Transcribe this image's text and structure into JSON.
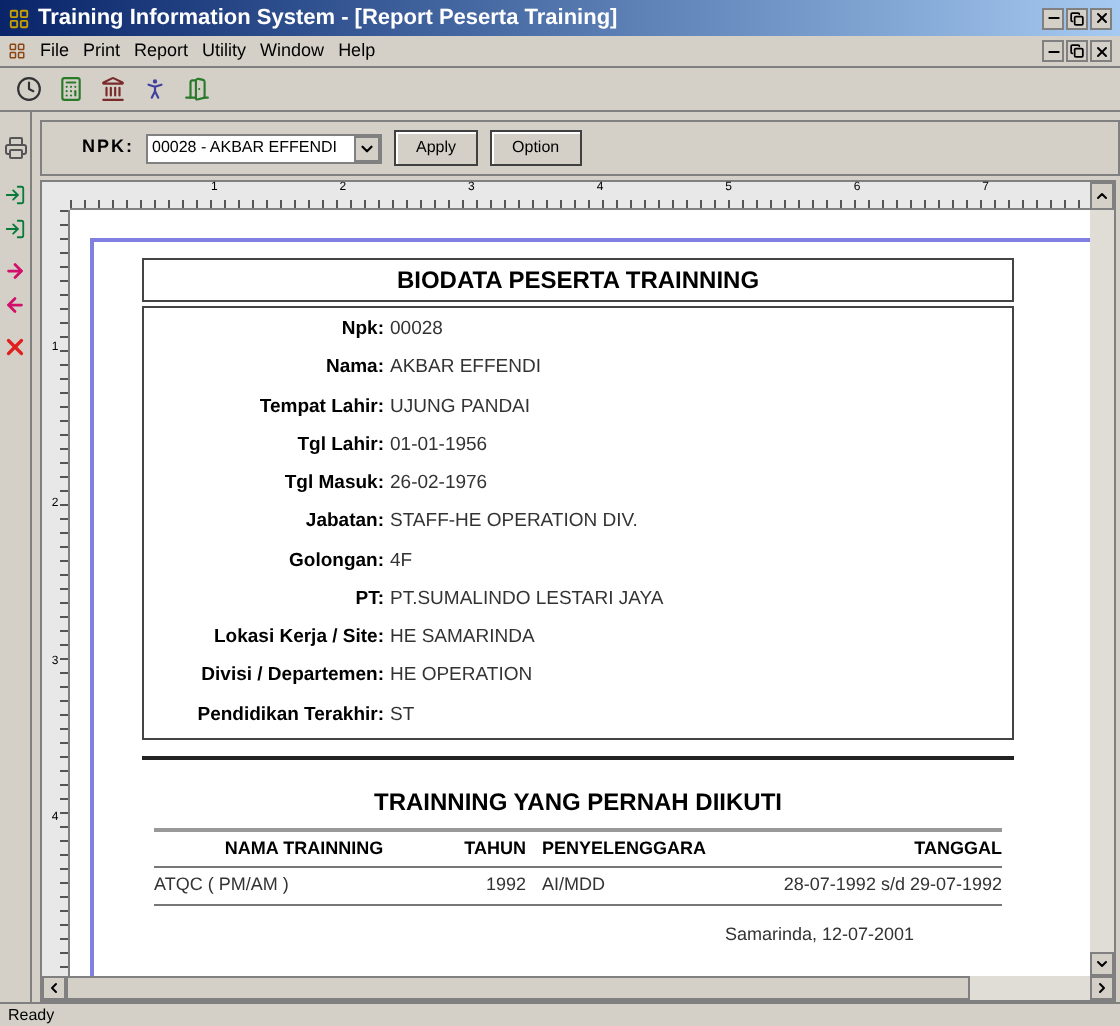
{
  "window": {
    "title": "Training Information System - [Report Peserta Training]"
  },
  "menu": [
    "File",
    "Print",
    "Report",
    "Utility",
    "Window",
    "Help"
  ],
  "report_toolbar": {
    "label": "NPK:",
    "npk_value": "00028 - AKBAR EFFENDI",
    "buttons": [
      "Apply",
      "Option"
    ]
  },
  "rulers": {
    "horizontal": [
      "1",
      "2",
      "3",
      "4",
      "5",
      "6",
      "7"
    ],
    "vertical": [
      "1",
      "2",
      "3",
      "4"
    ]
  },
  "report": {
    "title": "BIODATA PESERTA TRAINNING",
    "fields": [
      {
        "label": "Npk:",
        "value": "00028"
      },
      {
        "label": "Nama:",
        "value": "AKBAR EFFENDI"
      },
      {
        "label": "Tempat Lahir:",
        "value": "UJUNG PANDAI"
      },
      {
        "label": "Tgl Lahir:",
        "value": "01-01-1956"
      },
      {
        "label": "Tgl Masuk:",
        "value": "26-02-1976"
      },
      {
        "label": "Jabatan:",
        "value": "STAFF-HE OPERATION DIV."
      },
      {
        "label": "Golongan:",
        "value": "4F"
      },
      {
        "label": "PT:",
        "value": "PT.SUMALINDO LESTARI JAYA"
      },
      {
        "label": "Lokasi Kerja / Site:",
        "value": "HE SAMARINDA"
      },
      {
        "label": "Divisi / Departemen:",
        "value": "HE OPERATION"
      },
      {
        "label": "Pendidikan Terakhir:",
        "value": "ST"
      }
    ],
    "training_title": "TRAINNING YANG PERNAH DIIKUTI",
    "table": {
      "columns": [
        "NAMA TRAINNING",
        "TAHUN",
        "PENYELENGGARA",
        "TANGGAL"
      ],
      "rows": [
        [
          "ATQC ( PM/AM )",
          "1992",
          "AI/MDD",
          "28-07-1992 s/d 29-07-1992"
        ]
      ]
    },
    "signature_line": "Samarinda, 12-07-2001"
  },
  "status_bar": "Ready"
}
